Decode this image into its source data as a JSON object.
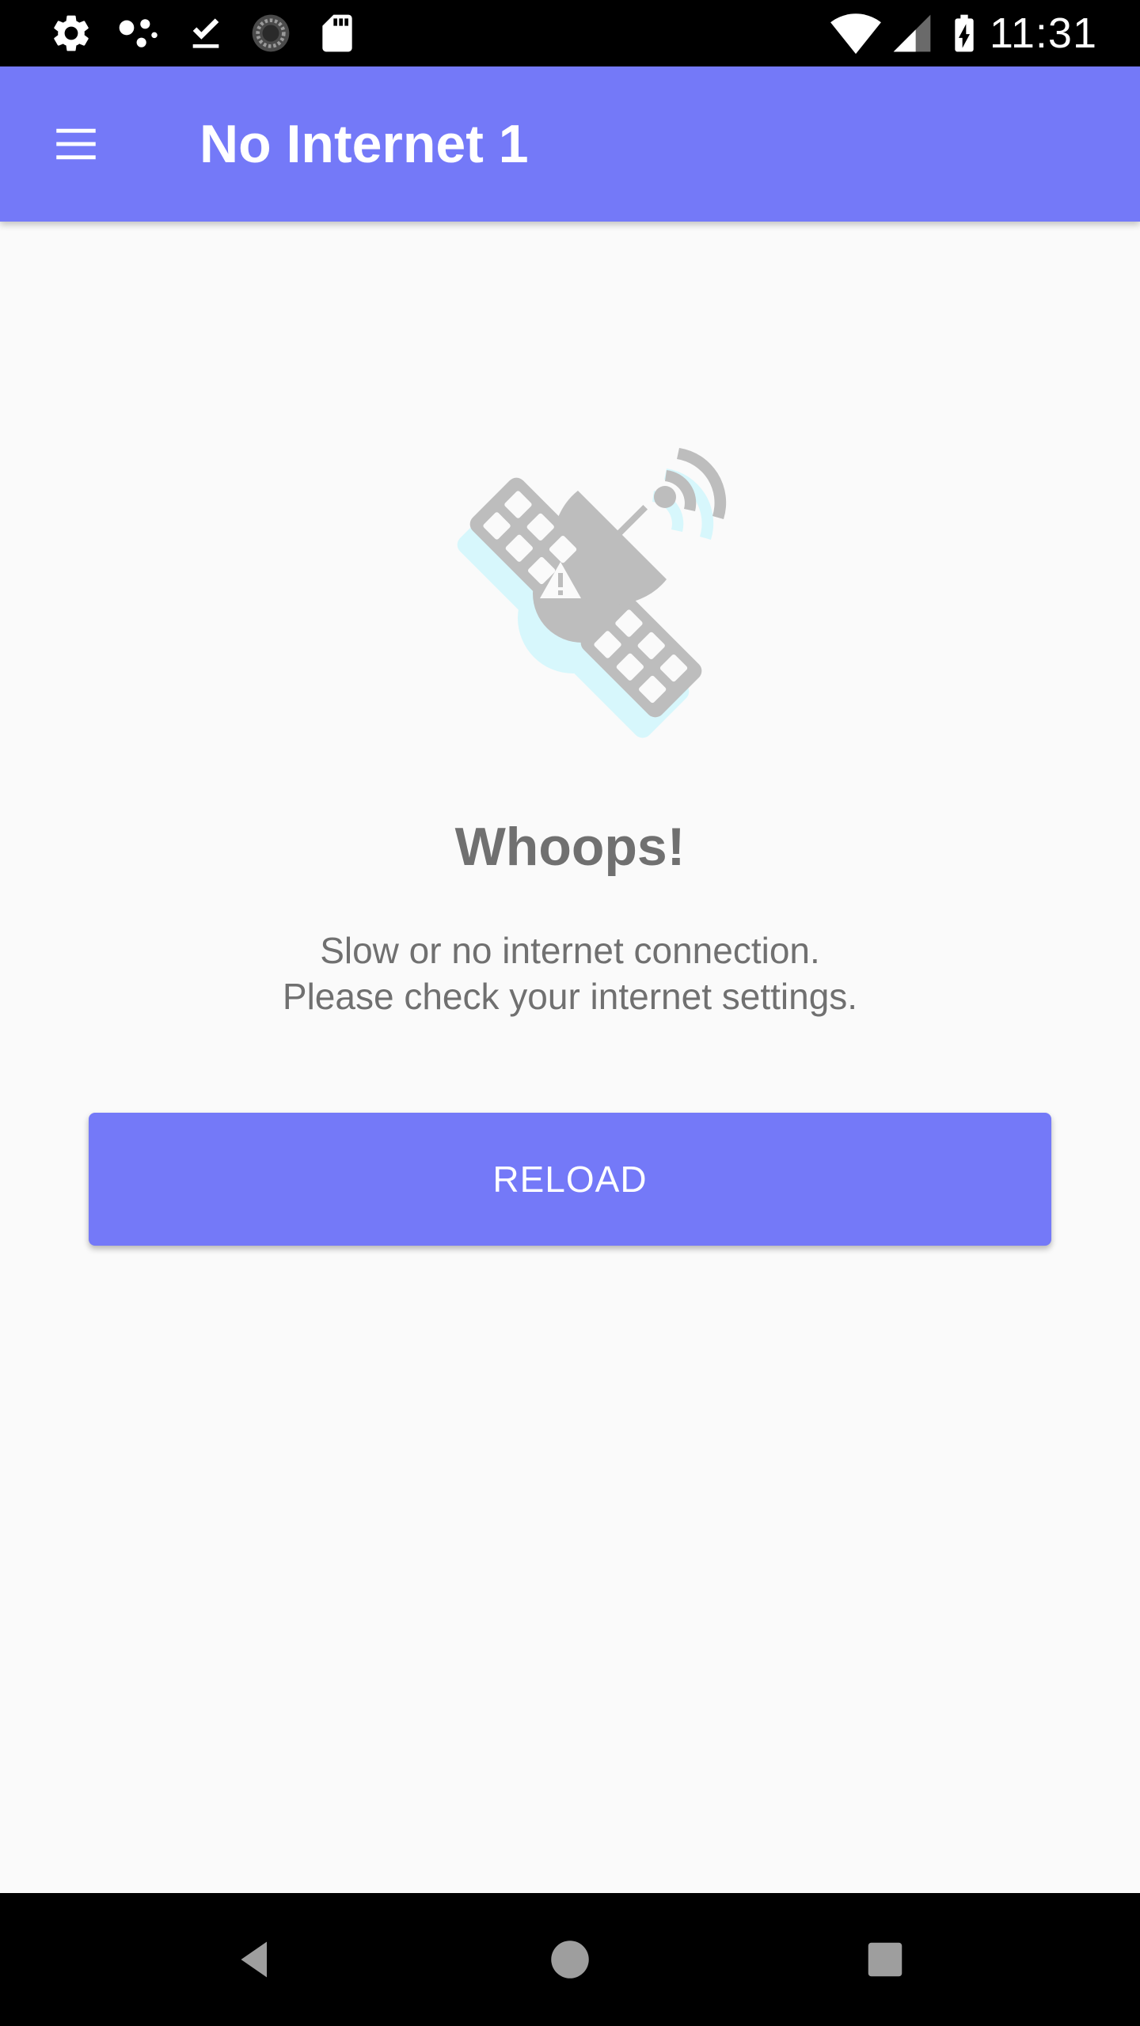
{
  "status_bar": {
    "time": "11:31",
    "left_icons": [
      "settings-icon",
      "dots-icon",
      "download-done-icon",
      "sync-icon",
      "sd-card-icon"
    ],
    "right_icons": [
      "wifi-icon",
      "cell-signal-icon",
      "battery-charging-icon"
    ]
  },
  "app_bar": {
    "title": "No Internet 1",
    "menu_icon": "menu-icon",
    "color": "#7479f8"
  },
  "content": {
    "illustration_icon": "satellite-icon",
    "heading": "Whoops!",
    "message_line1": "Slow or no internet connection.",
    "message_line2": "Please check your internet settings.",
    "reload_label": "RELOAD"
  },
  "nav_bar": {
    "icons": [
      "back-icon",
      "home-icon",
      "recents-icon"
    ]
  }
}
